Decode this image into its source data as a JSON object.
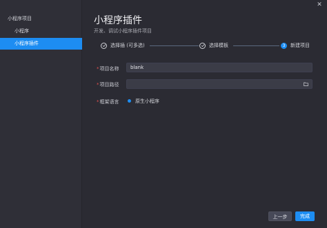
{
  "sidebar": {
    "group_title": "小程序项目",
    "items": [
      {
        "label": "小程序",
        "selected": false
      },
      {
        "label": "小程序插件",
        "selected": true
      }
    ]
  },
  "header": {
    "title": "小程序插件",
    "subtitle": "开发、调试小程序插件项目"
  },
  "steps": [
    {
      "label": "选择插 (可多选)",
      "status": "done",
      "icon": "check-circle-icon"
    },
    {
      "label": "选择模板",
      "status": "done",
      "icon": "check-circle-icon"
    },
    {
      "label": "新建项目",
      "status": "active",
      "number": "3"
    }
  ],
  "form": {
    "project_name_label": "项目名称",
    "project_name_value": "blank",
    "project_path_label": "项目路径",
    "project_path_value": "",
    "framework_label": "框架语言",
    "framework_option": "原生小程序"
  },
  "buttons": {
    "prev_label": "上一步",
    "done_label": "完成"
  },
  "colors": {
    "accent": "#1d8df2",
    "required": "#e0514f",
    "background": "#2b2b33",
    "sidebar": "#2f2f37"
  }
}
